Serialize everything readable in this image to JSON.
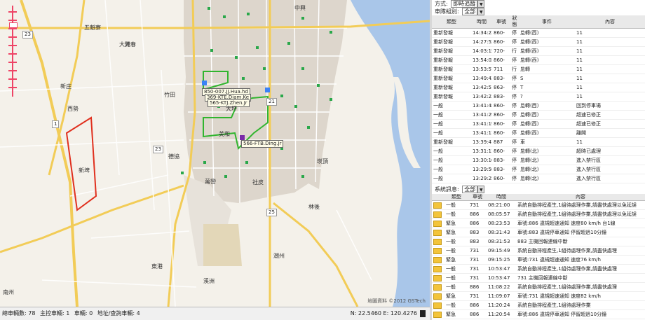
{
  "map": {
    "copyright": "地圖資料 ©2012 GSTech",
    "road_numbers": [
      "23",
      "1",
      "21",
      "25",
      "23"
    ],
    "tags": [
      "850-007.JJ.Hua.hd",
      "369-KTE.Diam.Ke",
      "566-FTB.Ding.Jr",
      "565-KTJ.Zhen.Jr"
    ],
    "labels": [
      "大陳",
      "美和",
      "大坪",
      "竹田",
      "西勢",
      "中興",
      "萬巒",
      "新埤",
      "潮州",
      "光春",
      "德協",
      "五魁寮",
      "新庄",
      "社皮",
      "林後",
      "崁頂",
      "南州",
      "溪洲",
      "東港"
    ]
  },
  "statusbar": {
    "items": [
      "總車輛數: 78",
      "主控車輛: 1",
      "車輛: 0",
      "地址/查詢車輛: 4"
    ],
    "coords": "N: 22.5460 E: 120.4276"
  },
  "panel": {
    "mode_label": "方式:",
    "mode_value": "即時追蹤",
    "group_label": "車隊組別:",
    "group_value": "全部",
    "table1": {
      "headers": [
        "類型",
        "時間",
        "車號",
        "狀態",
        "事件",
        "內容"
      ],
      "rows": [
        [
          "重新發報",
          "14:34:23",
          "860-",
          "停",
          "怠轉(西)",
          "11"
        ],
        [
          "重新發報",
          "14:27:52",
          "860-",
          "停",
          "怠轉(西)",
          "11"
        ],
        [
          "重新發報",
          "14:03:15",
          "720-",
          "行",
          "怠轉(西)",
          "11"
        ],
        [
          "重新發報",
          "13:54:02",
          "860-",
          "停",
          "怠轉(西)",
          "11"
        ],
        [
          "重新發報",
          "13:53:57",
          "711",
          "行",
          "怠轉",
          "11"
        ],
        [
          "重新發報",
          "13:49:43",
          "883-",
          "停",
          "S",
          "11"
        ],
        [
          "重新發報",
          "13:42:51",
          "863-",
          "停",
          "T",
          "11"
        ],
        [
          "重新發報",
          "13:42:23",
          "883-",
          "停",
          "?",
          "11"
        ],
        [
          "一般",
          "13:41:48",
          "860-",
          "停",
          "怠轉(西)",
          "回到停車場"
        ],
        [
          "一般",
          "13:41:29",
          "860-",
          "停",
          "怠轉(西)",
          "超速已修正"
        ],
        [
          "一般",
          "13:41:19",
          "860-",
          "停",
          "怠轉(西)",
          "超速已修正"
        ],
        [
          "一般",
          "13:41:11",
          "860-",
          "停",
          "怠轉(西)",
          "離開"
        ],
        [
          "重新發報",
          "13:39:41",
          "887",
          "停",
          "車",
          "11"
        ],
        [
          "一般",
          "13:31:11",
          "860-",
          "停",
          "怠轉(北)",
          "超時已處理"
        ],
        [
          "一般",
          "13:30:16",
          "883-",
          "停",
          "怠轉(北)",
          "進入禁行區"
        ],
        [
          "一般",
          "13:29:58",
          "883-",
          "停",
          "怠轉(北)",
          "進入禁行區"
        ],
        [
          "一般",
          "13:29:25",
          "860-",
          "停",
          "怠轉(北)",
          "進入禁行區"
        ],
        [
          "一般",
          "13:19:24",
          "883-",
          "停",
          "怠轉(北)",
          "離開"
        ],
        [
          "一般",
          "13:14:20",
          "886-",
          "停",
          "行車(台)",
          "11"
        ]
      ]
    },
    "table2_label": "系統訊息:",
    "table2_value": "全部",
    "table2": {
      "headers": [
        "類型",
        "車號",
        "時間",
        "內容"
      ],
      "rows": [
        [
          "一般",
          "731",
          "08:21:00",
          "系統自動排程產生,1組待處理作業,請盡快處理以免延誤"
        ],
        [
          "一般",
          "886",
          "08:05:57",
          "系統自動排程產生,1組待處理作業,請盡快處理以免延誤"
        ],
        [
          "緊急",
          "886",
          "08:23:53",
          "車號:886 違規超速通知 速度80 km/h 台1線"
        ],
        [
          "緊急",
          "883",
          "08:31:43",
          "車號:883 違規停車通知 停留超過10分鐘"
        ],
        [
          "一般",
          "883",
          "08:31:53",
          "883 主機回報連線中斷"
        ],
        [
          "一般",
          "731",
          "09:15:49",
          "系統自動排程產生,1組待處理作業,請盡快處理"
        ],
        [
          "緊急",
          "731",
          "09:15:25",
          "車號:731 違規超速通知 速度76 km/h"
        ],
        [
          "一般",
          "731",
          "10:53:47",
          "系統自動排程產生,1組待處理作業,請盡快處理"
        ],
        [
          "一般",
          "731",
          "10:53:47",
          "731 主機回報連線中斷"
        ],
        [
          "一般",
          "886",
          "11:08:22",
          "系統自動排程產生,1組待處理作業,請盡快處理"
        ],
        [
          "緊急",
          "731",
          "11:09:07",
          "車號:731 違規超速通知 速度82 km/h"
        ],
        [
          "一般",
          "886",
          "11:20:24",
          "系統自動排程產生,1組待處理作業"
        ],
        [
          "緊急",
          "886",
          "11:20:54",
          "車號:886 違規停車通知 停留超過10分鐘"
        ]
      ]
    }
  }
}
